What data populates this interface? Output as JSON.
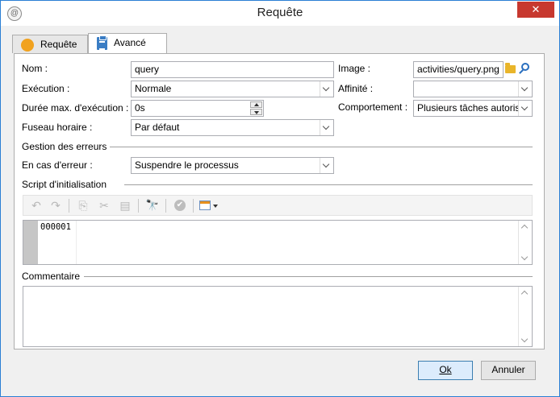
{
  "window": {
    "title": "Requête",
    "close_glyph": "✕",
    "app_icon_glyph": "@"
  },
  "tabs": [
    {
      "label": "Requête",
      "icon": "orange-dot-icon"
    },
    {
      "label": "Avancé",
      "icon": "clipboard-icon"
    }
  ],
  "form": {
    "nom_label": "Nom :",
    "nom_value": "query",
    "execution_label": "Exécution :",
    "execution_value": "Normale",
    "duree_label": "Durée max. d'exécution :",
    "duree_value": "0s",
    "fuseau_label": "Fuseau horaire :",
    "fuseau_value": "Par défaut",
    "image_label": "Image :",
    "image_value": "activities/query.png",
    "affinite_label": "Affinité :",
    "affinite_value": "",
    "comportement_label": "Comportement :",
    "comportement_value": "Plusieurs tâches autorisé"
  },
  "errors": {
    "section_label": "Gestion des erreurs",
    "on_error_label": "En cas d'erreur :",
    "on_error_value": "Suspendre le processus"
  },
  "script": {
    "section_label": "Script d'initialisation",
    "first_line_number": "000001",
    "toolbar_glyphs": {
      "undo": "↶",
      "redo": "↷",
      "copy": "⎘",
      "cut": "✂",
      "paste": "▤",
      "find": "🔭",
      "validate": "✔"
    }
  },
  "comment": {
    "section_label": "Commentaire"
  },
  "buttons": {
    "ok_label": "Ok",
    "cancel_label": "Annuler"
  }
}
